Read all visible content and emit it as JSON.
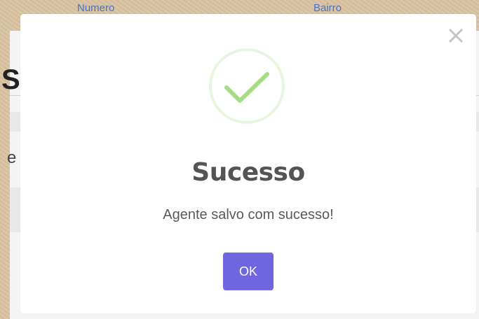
{
  "background": {
    "columns": [
      {
        "label": "Numero"
      },
      {
        "label": "Bairro"
      }
    ],
    "partial_heading": "S",
    "partial_text": "e"
  },
  "modal": {
    "title": "Sucesso",
    "message": "Agente salvo com sucesso!",
    "ok_label": "OK",
    "icon": "success-check-icon",
    "close_icon": "close-icon"
  },
  "colors": {
    "confirm_button": "#7066e0",
    "success_check": "#a5dc86",
    "success_ring": "#e8f6df"
  }
}
